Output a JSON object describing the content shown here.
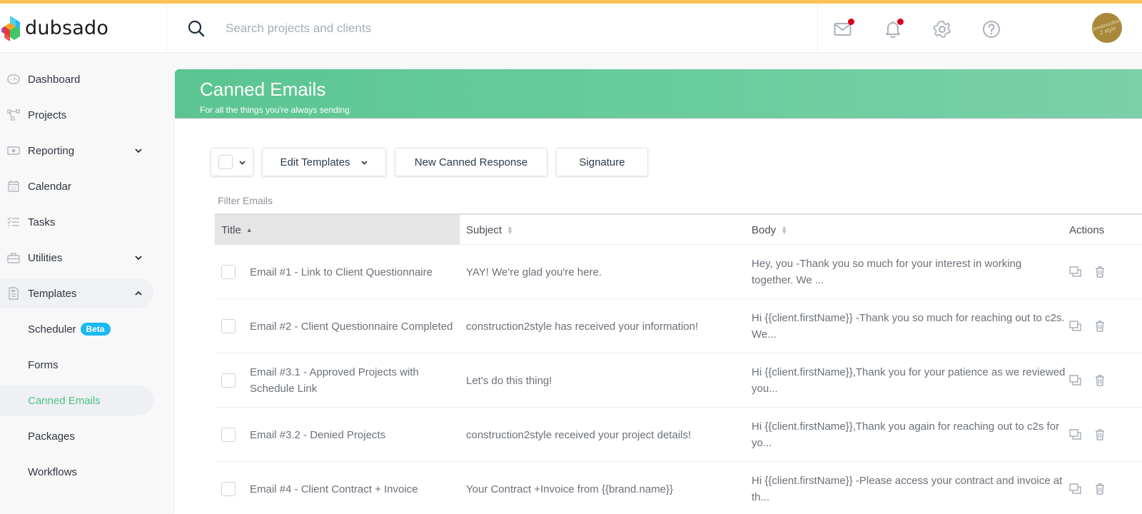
{
  "app": {
    "brand_name": "dubsado",
    "accent_color": "#fdc15a",
    "brand_green": "#5bc592"
  },
  "header": {
    "search_placeholder": "Search projects and clients",
    "icons": [
      "mail-icon",
      "bell-icon",
      "gear-icon",
      "help-icon"
    ],
    "mail_has_notification": true,
    "bell_has_notification": true,
    "avatar_text_line1": "construction",
    "avatar_text_line2": "2 style"
  },
  "sidebar": {
    "items": [
      {
        "label": "Dashboard",
        "icon": "gauge-icon"
      },
      {
        "label": "Projects",
        "icon": "projects-icon"
      },
      {
        "label": "Reporting",
        "icon": "money-icon",
        "expandable": true
      },
      {
        "label": "Calendar",
        "icon": "calendar-icon"
      },
      {
        "label": "Tasks",
        "icon": "tasks-icon"
      },
      {
        "label": "Utilities",
        "icon": "toolbox-icon",
        "expandable": true
      },
      {
        "label": "Templates",
        "icon": "document-icon",
        "expandable": true,
        "expanded": true
      },
      {
        "label": "Scheduler",
        "badge": "Beta"
      },
      {
        "label": "Forms"
      },
      {
        "label": "Canned Emails",
        "active": true
      },
      {
        "label": "Packages"
      },
      {
        "label": "Workflows"
      }
    ]
  },
  "page": {
    "title": "Canned Emails",
    "subtitle": "For all the things you're always sending"
  },
  "toolbar": {
    "edit_templates_label": "Edit Templates",
    "new_response_label": "New Canned Response",
    "signature_label": "Signature"
  },
  "filter": {
    "placeholder": "Filter Emails",
    "value": ""
  },
  "table": {
    "columns": {
      "title": "Title",
      "subject": "Subject",
      "body": "Body",
      "actions": "Actions"
    },
    "sort": {
      "column": "Title",
      "direction": "ascending"
    },
    "rows": [
      {
        "title": "Email #1 - Link to Client Questionnaire",
        "subject": "YAY! We're glad you're here.",
        "body": "Hey, you -Thank you so much for your interest in working together. We ..."
      },
      {
        "title": "Email #2 - Client Questionnaire Completed",
        "subject": "construction2style has received your information!",
        "body": "Hi {{client.firstName}} -Thank you so much for reaching out to c2s. We..."
      },
      {
        "title": "Email #3.1 - Approved Projects with Schedule Link",
        "subject": "Let's do this thing!",
        "body": "Hi {{client.firstName}},Thank you for your patience as we reviewed you..."
      },
      {
        "title": "Email #3.2 - Denied Projects",
        "subject": "construction2style received your project details!",
        "body": "Hi {{client.firstName}},Thank you again for reaching out to c2s for yo..."
      },
      {
        "title": "Email #4 - Client Contract + Invoice",
        "subject": "Your Contract +Invoice from {{brand.name}}",
        "body": "Hi {{client.firstName}} -Please access your contract and invoice at th..."
      }
    ]
  }
}
